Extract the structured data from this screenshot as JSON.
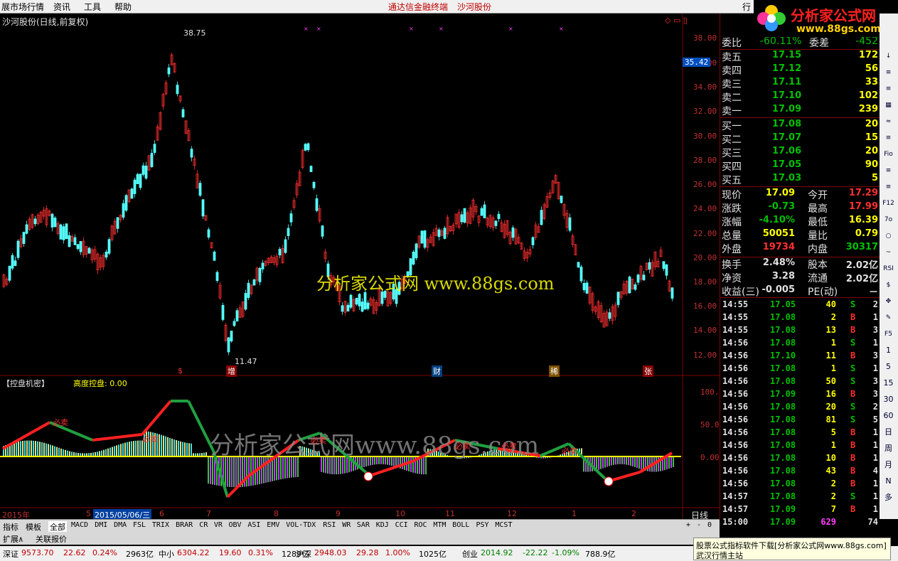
{
  "menu": {
    "items": [
      "展市场行情",
      "资讯",
      "工具",
      "帮助"
    ],
    "center_title": "通达信金融终端",
    "stock_name": "沙河股份",
    "right_btn": "行"
  },
  "logo": {
    "text": "分析家公式网",
    "url": "www.88gs.com"
  },
  "chart": {
    "title": "沙河股份(日线,前复权)",
    "y_ticks": [
      "38.00",
      "36.00",
      "35.42",
      "34.00",
      "32.00",
      "30.00",
      "28.00",
      "26.00",
      "24.00",
      "22.00",
      "20.00",
      "18.00",
      "16.00",
      "14.00",
      "12.00"
    ],
    "high_label": "38.75",
    "low_label": "11.47",
    "current_price": "35.42",
    "event_markers": [
      "$",
      "增",
      "财",
      "稀",
      "张"
    ],
    "watermark": "分析家公式网 www.88gs.com"
  },
  "indicator": {
    "title": "【控盘机密】",
    "param_label": "高度控盘: 0.00",
    "y_ticks": [
      "100.0",
      "50.00",
      "0.00"
    ],
    "labels": [
      "必卖",
      "必卖",
      "必卖",
      "必卖",
      "必卖",
      "必卖"
    ],
    "watermark": "分析家公式网www.88gs.com"
  },
  "xaxis": {
    "labels": [
      "2015年",
      "5",
      "2015/05/06/三",
      "6",
      "7",
      "8",
      "9",
      "10",
      "11",
      "12",
      "1",
      "2"
    ],
    "period": "日线"
  },
  "tabs": {
    "items": [
      "指标",
      "模板",
      "全部",
      "MACD",
      "DMI",
      "DMA",
      "FSL",
      "TRIX",
      "BRAR",
      "CR",
      "VR",
      "OBV",
      "ASI",
      "EMV",
      "VOL-TDX",
      "RSI",
      "WR",
      "SAR",
      "KDJ",
      "CCI",
      "ROC",
      "MTM",
      "BOLL",
      "PSY",
      "MCST"
    ],
    "extra": [
      "扩展∧",
      "关联报价"
    ],
    "ctrl": [
      "+",
      "-",
      "0"
    ]
  },
  "quote": {
    "weibi": {
      "label": "委比",
      "value": "-60.11%",
      "label2": "委差",
      "value2": "-452"
    },
    "asks": [
      {
        "label": "卖五",
        "price": "17.15",
        "vol": "172"
      },
      {
        "label": "卖四",
        "price": "17.12",
        "vol": "56"
      },
      {
        "label": "卖三",
        "price": "17.11",
        "vol": "33"
      },
      {
        "label": "卖二",
        "price": "17.10",
        "vol": "102"
      },
      {
        "label": "卖一",
        "price": "17.09",
        "vol": "239"
      }
    ],
    "bids": [
      {
        "label": "买一",
        "price": "17.08",
        "vol": "20"
      },
      {
        "label": "买二",
        "price": "17.07",
        "vol": "15"
      },
      {
        "label": "买三",
        "price": "17.06",
        "vol": "20"
      },
      {
        "label": "买四",
        "price": "17.05",
        "vol": "90"
      },
      {
        "label": "买五",
        "price": "17.03",
        "vol": "5"
      }
    ],
    "stats": [
      {
        "l1": "现价",
        "v1": "17.09",
        "l2": "今开",
        "v2": "17.29"
      },
      {
        "l1": "涨跌",
        "v1": "-0.73",
        "l2": "最高",
        "v2": "17.99"
      },
      {
        "l1": "涨幅",
        "v1": "-4.10%",
        "l2": "最低",
        "v2": "16.39"
      },
      {
        "l1": "总量",
        "v1": "50051",
        "l2": "量比",
        "v2": "0.79"
      },
      {
        "l1": "外盘",
        "v1": "19734",
        "l2": "内盘",
        "v2": "30317"
      },
      {
        "l1": "换手",
        "v1": "2.48%",
        "l2": "股本",
        "v2": "2.02亿"
      },
      {
        "l1": "净资",
        "v1": "3.28",
        "l2": "流通",
        "v2": "2.02亿"
      },
      {
        "l1": "收益(三)",
        "v1": "-0.005",
        "l2": "PE(动)",
        "v2": "－"
      }
    ],
    "ticks": [
      {
        "t": "14:55",
        "p": "17.05",
        "v": "40",
        "bs": "S",
        "n": "2"
      },
      {
        "t": "14:55",
        "p": "17.08",
        "v": "2",
        "bs": "B",
        "n": "1"
      },
      {
        "t": "14:55",
        "p": "17.08",
        "v": "13",
        "bs": "B",
        "n": "3"
      },
      {
        "t": "14:56",
        "p": "17.08",
        "v": "1",
        "bs": "S",
        "n": "1"
      },
      {
        "t": "14:56",
        "p": "17.10",
        "v": "11",
        "bs": "B",
        "n": "3"
      },
      {
        "t": "14:56",
        "p": "17.08",
        "v": "1",
        "bs": "S",
        "n": "1"
      },
      {
        "t": "14:56",
        "p": "17.08",
        "v": "50",
        "bs": "S",
        "n": "3"
      },
      {
        "t": "14:56",
        "p": "17.09",
        "v": "16",
        "bs": "B",
        "n": "3"
      },
      {
        "t": "14:56",
        "p": "17.08",
        "v": "20",
        "bs": "S",
        "n": "2"
      },
      {
        "t": "14:56",
        "p": "17.08",
        "v": "81",
        "bs": "S",
        "n": "5"
      },
      {
        "t": "14:56",
        "p": "17.08",
        "v": "5",
        "bs": "B",
        "n": "1"
      },
      {
        "t": "14:56",
        "p": "17.08",
        "v": "1",
        "bs": "B",
        "n": "1"
      },
      {
        "t": "14:56",
        "p": "17.08",
        "v": "10",
        "bs": "B",
        "n": "1"
      },
      {
        "t": "14:56",
        "p": "17.08",
        "v": "43",
        "bs": "B",
        "n": "4"
      },
      {
        "t": "14:56",
        "p": "17.08",
        "v": "2",
        "bs": "B",
        "n": "1"
      },
      {
        "t": "14:57",
        "p": "17.08",
        "v": "2",
        "bs": "S",
        "n": "1"
      },
      {
        "t": "14:57",
        "p": "17.09",
        "v": "7",
        "bs": "B",
        "n": "1"
      },
      {
        "t": "15:00",
        "p": "17.09",
        "v": "629",
        "bs": "",
        "n": "74"
      }
    ]
  },
  "right_toolbar": [
    "↓",
    "≡",
    "≡",
    "▦",
    "≈",
    "≡",
    "Fio",
    "≡",
    "≡",
    "F12",
    "7o",
    "○",
    "~",
    "RSI",
    "$",
    "✥",
    "✎",
    "F5",
    "1",
    "5",
    "15",
    "30",
    "60",
    "日",
    "周",
    "月",
    "N",
    "多"
  ],
  "status": {
    "items": [
      {
        "name": "深证",
        "value": "9573.70",
        "chg": "22.62",
        "pct": "0.24%",
        "amt": "2963亿"
      },
      {
        "name": "中小",
        "value": "6304.22",
        "chg": "19.60",
        "pct": "0.31%",
        "amt": "1289亿"
      },
      {
        "name": "沪深",
        "value": "2948.03",
        "chg": "29.28",
        "pct": "1.00%",
        "amt": "1025亿"
      },
      {
        "name": "创业",
        "value": "2014.92",
        "chg": "-22.22",
        "pct": "-1.09%",
        "amt": "788.9亿"
      }
    ],
    "ad_text": "股票公式指标软件下载[分析家公式网www.88gs.com]",
    "ad_sub": "武汉行情主站"
  },
  "colors": {
    "up": "#ff3030",
    "down": "#54ffff",
    "axis": "#a00000",
    "bg": "#000000"
  }
}
